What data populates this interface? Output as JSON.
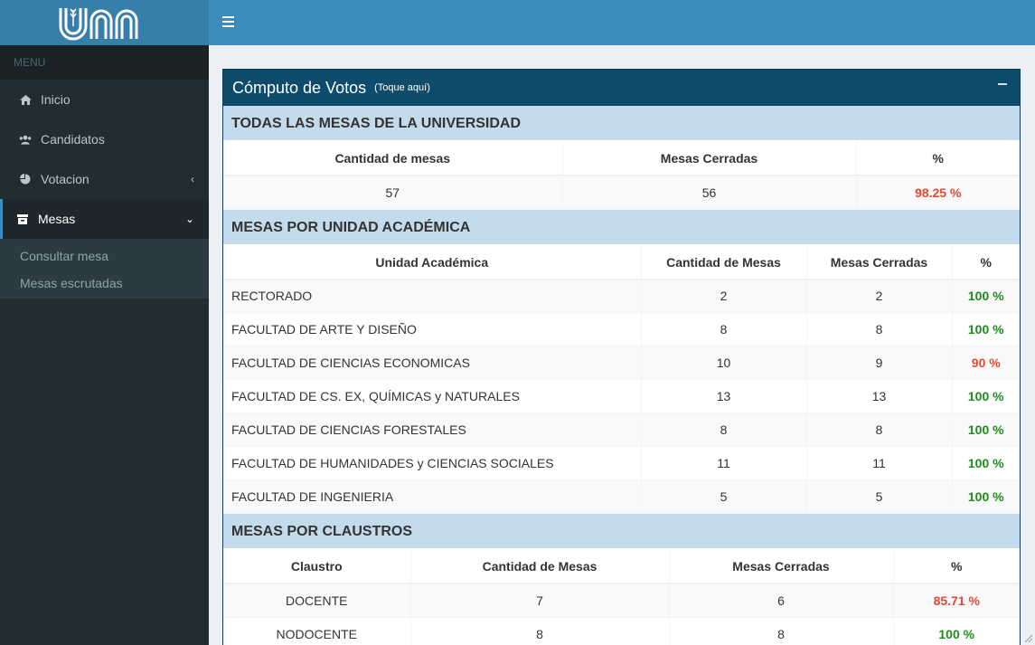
{
  "sidebar": {
    "menu_header": "MENU",
    "items": [
      {
        "label": "Inicio",
        "icon": "home-icon"
      },
      {
        "label": "Candidatos",
        "icon": "users-icon"
      },
      {
        "label": "Votacion",
        "icon": "pie-chart-icon"
      },
      {
        "label": "Mesas",
        "icon": "table-icon"
      }
    ],
    "submenu": [
      "Consultar mesa",
      "Mesas escrutadas"
    ]
  },
  "box": {
    "title": "Cómputo de Votos",
    "hint": "(Toque aquí)"
  },
  "section_total": {
    "title": "TODAS LAS MESAS DE LA UNIVERSIDAD",
    "headers": [
      "Cantidad de mesas",
      "Mesas Cerradas",
      "%"
    ],
    "row": [
      "57",
      "56",
      "98.25 %"
    ]
  },
  "section_unidad": {
    "title": "MESAS POR UNIDAD ACADÉMICA",
    "headers": [
      "Unidad Académica",
      "Cantidad de Mesas",
      "Mesas Cerradas",
      "%"
    ],
    "rows": [
      [
        "RECTORADO",
        "2",
        "2",
        "100 %"
      ],
      [
        "FACULTAD DE ARTE Y DISEÑO",
        "8",
        "8",
        "100 %"
      ],
      [
        "FACULTAD DE CIENCIAS ECONOMICAS",
        "10",
        "9",
        "90 %"
      ],
      [
        "FACULTAD DE CS. EX, QUÍMICAS y NATURALES",
        "13",
        "13",
        "100 %"
      ],
      [
        "FACULTAD DE CIENCIAS FORESTALES",
        "8",
        "8",
        "100 %"
      ],
      [
        "FACULTAD DE HUMANIDADES y CIENCIAS SOCIALES",
        "11",
        "11",
        "100 %"
      ],
      [
        "FACULTAD DE INGENIERIA",
        "5",
        "5",
        "100 %"
      ]
    ]
  },
  "section_claustros": {
    "title": "MESAS POR CLAUSTROS",
    "headers": [
      "Claustro",
      "Cantidad de Mesas",
      "Mesas Cerradas",
      "%"
    ],
    "rows": [
      [
        "DOCENTE",
        "7",
        "6",
        "85.71 %"
      ],
      [
        "NODOCENTE",
        "8",
        "8",
        "100 %"
      ]
    ]
  },
  "colors": {
    "header_blue": "#3c8dbc",
    "logo_blue": "#367fa9",
    "sidebar_dark": "#222d32",
    "box_header": "#0f4c6b",
    "section_bg": "#c4dbec",
    "pct_red": "#dd4b39",
    "pct_green": "#00a65a"
  }
}
